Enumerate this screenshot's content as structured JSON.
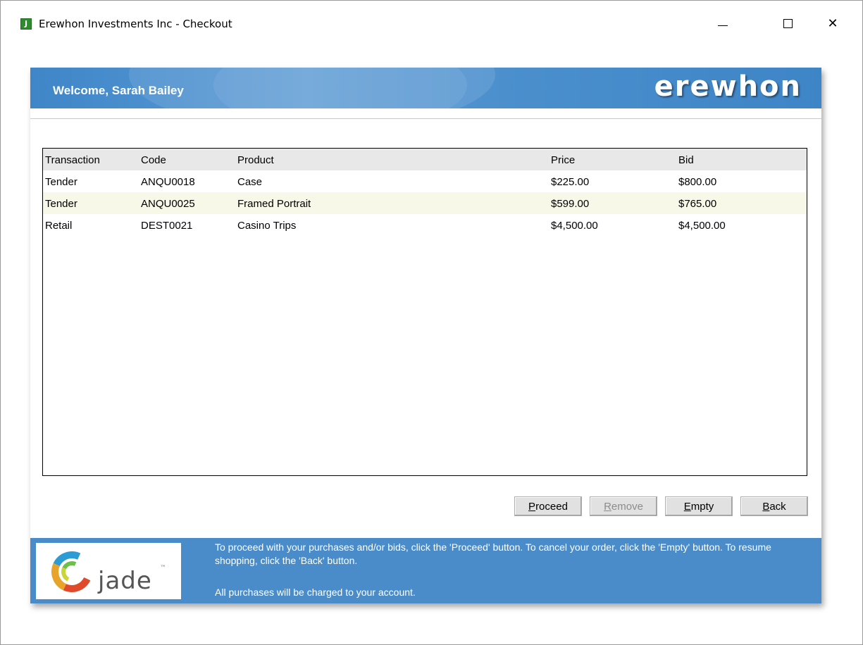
{
  "window": {
    "title": "Erewhon Investments Inc - Checkout",
    "icon_letter": "J",
    "controls": [
      "minimize-icon",
      "maximize-icon",
      "close-icon"
    ]
  },
  "banner": {
    "welcome": "Welcome, Sarah Bailey",
    "brand": "erewhon"
  },
  "list": {
    "columns": [
      "Transaction",
      "Code",
      "Product",
      "Price",
      "Bid"
    ],
    "rows": [
      [
        "Tender",
        "ANQU0018",
        "Case",
        "$225.00",
        "$800.00"
      ],
      [
        "Tender",
        "ANQU0025",
        "Framed Portrait",
        "$599.00",
        "$765.00"
      ],
      [
        "Retail",
        "DEST0021",
        "Casino Trips",
        "$4,500.00",
        "$4,500.00"
      ]
    ]
  },
  "buttons": {
    "proceed": "Proceed",
    "remove": "Remove",
    "empty": "Empty",
    "back": "Back"
  },
  "footer": {
    "logo_text": "jade",
    "instructions": "To proceed with your purchases and/or bids, click the 'Proceed' button.  To cancel your order, click the 'Empty' button.  To resume shopping, click the 'Back' button.",
    "note": "All purchases will be charged to your account."
  },
  "colors": {
    "banner": "#4a8cca",
    "selected_row": "#f8f8e8",
    "header_row": "#e8e8e8"
  }
}
